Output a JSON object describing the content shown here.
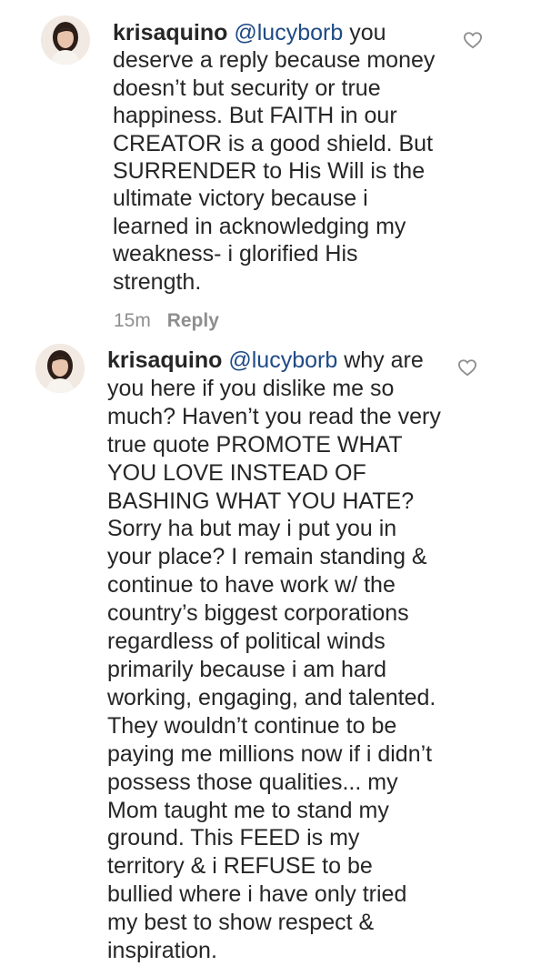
{
  "comments": [
    {
      "username": "krisaquino",
      "mention": "@lucyborb",
      "text": "you deserve a reply because money doesn’t but security or true happiness. But FAITH in our CREATOR is a good shield. But SURRENDER to His Will is the ultimate victory because i learned in acknowledging my weakness- i glorified His strength.",
      "time": "15m",
      "reply_label": "Reply"
    },
    {
      "username": "krisaquino",
      "mention": "@lucyborb",
      "text": "why are you here if you dislike me so much? Haven’t you read the very true quote PROMOTE WHAT YOU LOVE INSTEAD OF BASHING WHAT YOU HATE? Sorry ha but may i put you in your place? I remain standing & continue to have work w/ the country’s biggest corporations regardless of political winds primarily because i am hard working, engaging, and talented. They wouldn’t continue to be paying me millions now if i didn’t possess those qualities... my Mom taught me to stand my ground. This FEED is my territory & i REFUSE to be bullied where i have only tried my best to show respect & inspiration."
    }
  ],
  "icons": {
    "avatar": "profile-photo",
    "like": "heart-outline-icon"
  }
}
